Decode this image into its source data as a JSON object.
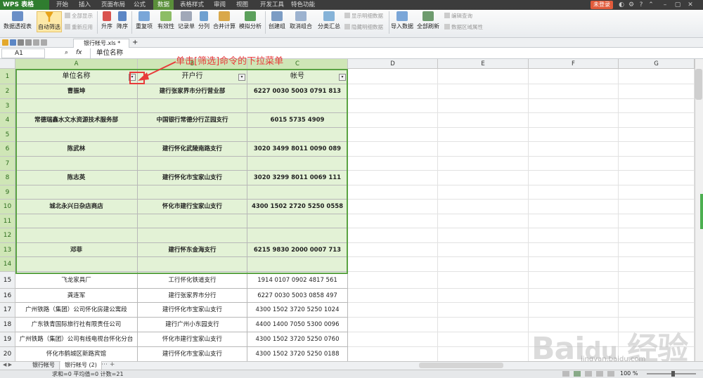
{
  "app": {
    "name": "WPS 表格",
    "login": "未登录"
  },
  "menu": [
    "开始",
    "插入",
    "页面布局",
    "公式",
    "数据",
    "表格样式",
    "审阅",
    "视图",
    "开发工具",
    "特色功能"
  ],
  "menu_active_index": 4,
  "ribbon": {
    "pivot": "数据透视表",
    "autofilter": "自动筛选",
    "show_all": "全部显示",
    "reapply": "重新应用",
    "sort_asc": "升序",
    "sort_desc": "降序",
    "duplicates": "重复项",
    "validity": "有效性",
    "form": "记录单",
    "split": "分列",
    "consolidate": "合并计算",
    "simulate": "模拟分析",
    "group": "创建组",
    "ungroup": "取消组合",
    "subtotal": "分类汇总",
    "show_detail": "显示明细数据",
    "hide_detail": "隐藏明细数据",
    "import": "导入数据",
    "refresh_all": "全部刷新",
    "edit_query": "编辑查询",
    "range_props": "数据区域属性"
  },
  "document": {
    "tab": "银行帐号.xls *"
  },
  "formula_bar": {
    "cell_ref": "A1",
    "value": "单位名称"
  },
  "annotation": "单击[筛选]命令的下拉菜单",
  "columns": [
    "A",
    "B",
    "C",
    "D",
    "E",
    "F",
    "G"
  ],
  "header_row": [
    "单位名称",
    "开户行",
    "帐号"
  ],
  "rows": [
    [
      "曹振坤",
      "建行张家界市分行营业部",
      "6227 0030 5003 0791 813"
    ],
    [
      "",
      "",
      ""
    ],
    [
      "常德瑞鑫水文水资源技术服务部",
      "中国银行常德分行芷园支行",
      "6015 5735 4909"
    ],
    [
      "",
      "",
      ""
    ],
    [
      "陈武林",
      "建行怀化武陵南路支行",
      "3020 3499 8011 0090 089"
    ],
    [
      "",
      "",
      ""
    ],
    [
      "陈志英",
      "建行怀化市宝家山支行",
      "3020 3299 8011 0069 111"
    ],
    [
      "",
      "",
      ""
    ],
    [
      "城北永兴日杂店商店",
      "怀化市建行宝家山支行",
      "4300 1502 2720 5250 0558"
    ],
    [
      "",
      "",
      ""
    ],
    [
      "",
      "",
      ""
    ],
    [
      "邓菲",
      "建行怀东金海支行",
      "6215 9830 2000 0007 713"
    ],
    [
      "",
      "",
      ""
    ],
    [
      "飞龙家具厂",
      "工行怀化铁道支行",
      "1914 0107 0902 4817 561"
    ],
    [
      "龚连军",
      "建行张家界市分行",
      "6227 0030 5003 0858 497"
    ],
    [
      "广州铁路（集团）公司怀化房建公寓段",
      "建行怀化市宝家山支行",
      "4300 1502 3720 5250 1024"
    ],
    [
      "广东铁青国际旅行社有限责任公司",
      "建行广州小东园支行",
      "4400 1400 7050 5300 0096"
    ],
    [
      "广州铁路（集团）公司有线电视台怀化分台",
      "怀化市建行宝家山支行",
      "4300 1502 3720 5250 0760"
    ],
    [
      "怀化市鹤城区新路宾馆",
      "建行怀化市宝家山支行",
      "4300 1502 3720 5250 0188"
    ]
  ],
  "sheets": [
    "银行帐号",
    "银行帐号 (2)"
  ],
  "status": {
    "text": "求和=0  平均值=0  计数=21",
    "zoom": "100 %"
  },
  "watermark": {
    "logo": "Baidu 经验",
    "url": "jingyan.baidu.com"
  }
}
